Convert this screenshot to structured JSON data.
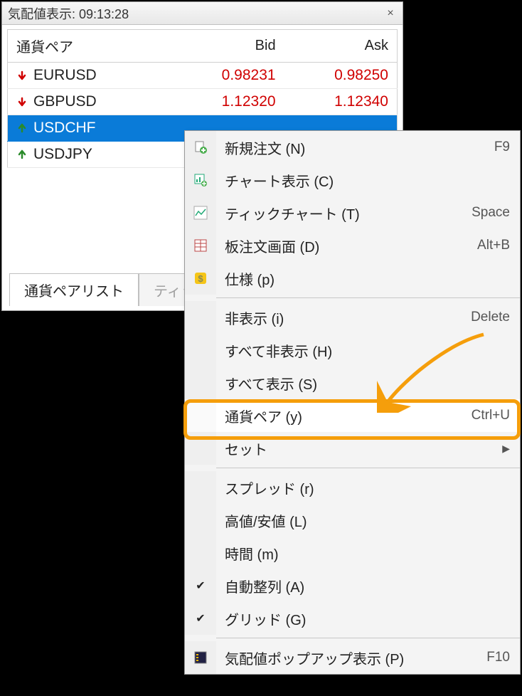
{
  "panel": {
    "title_prefix": "気配値表示: ",
    "time": "09:13:28"
  },
  "table": {
    "headers": {
      "symbol": "通貨ペア",
      "bid": "Bid",
      "ask": "Ask"
    },
    "rows": [
      {
        "symbol": "EURUSD",
        "bid": "0.98231",
        "ask": "0.98250",
        "dir": "down",
        "selected": false
      },
      {
        "symbol": "GBPUSD",
        "bid": "1.12320",
        "ask": "1.12340",
        "dir": "down",
        "selected": false
      },
      {
        "symbol": "USDCHF",
        "bid": "",
        "ask": "",
        "dir": "up",
        "selected": true
      },
      {
        "symbol": "USDJPY",
        "bid": "",
        "ask": "",
        "dir": "up",
        "selected": false
      }
    ]
  },
  "tabs": {
    "active": "通貨ペアリスト",
    "inactive": "ティッ"
  },
  "menu": {
    "groups": [
      [
        {
          "icon": "doc-plus",
          "label": "新規注文 (N)",
          "shortcut": "F9"
        },
        {
          "icon": "chart-plus",
          "label": "チャート表示 (C)",
          "shortcut": ""
        },
        {
          "icon": "tick-chart",
          "label": "ティックチャート (T)",
          "shortcut": "Space"
        },
        {
          "icon": "grid-order",
          "label": "板注文画面 (D)",
          "shortcut": "Alt+B"
        },
        {
          "icon": "spec",
          "label": "仕様 (p)",
          "shortcut": ""
        }
      ],
      [
        {
          "icon": "",
          "label": "非表示 (i)",
          "shortcut": "Delete"
        },
        {
          "icon": "",
          "label": "すべて非表示 (H)",
          "shortcut": ""
        },
        {
          "icon": "",
          "label": "すべて表示 (S)",
          "shortcut": ""
        },
        {
          "icon": "",
          "label": "通貨ペア (y)",
          "shortcut": "Ctrl+U",
          "highlight": true
        },
        {
          "icon": "",
          "label": "セット",
          "shortcut": "",
          "submenu": true
        }
      ],
      [
        {
          "icon": "",
          "label": "スプレッド (r)",
          "shortcut": ""
        },
        {
          "icon": "",
          "label": "高値/安値 (L)",
          "shortcut": ""
        },
        {
          "icon": "",
          "label": "時間 (m)",
          "shortcut": ""
        },
        {
          "icon": "check",
          "label": "自動整列 (A)",
          "shortcut": ""
        },
        {
          "icon": "check",
          "label": "グリッド (G)",
          "shortcut": ""
        }
      ],
      [
        {
          "icon": "popup",
          "label": "気配値ポップアップ表示 (P)",
          "shortcut": "F10"
        }
      ]
    ]
  }
}
